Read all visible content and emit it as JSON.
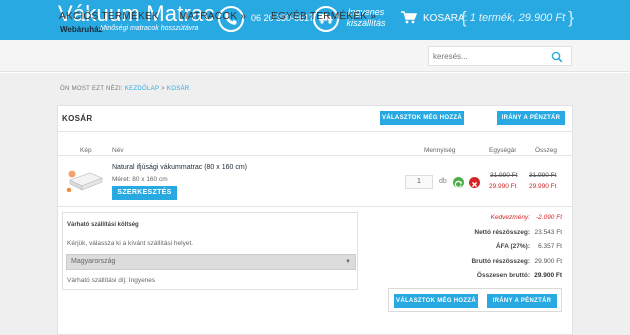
{
  "header": {
    "logo_title": "Vákuum Matrac",
    "logo_sub": "Webáruház",
    "logo_tagline": "Minőségi matracok hosszútávra",
    "phone": "06 20 330-6617",
    "shipping_line1": "Ingyenes",
    "shipping_line2": "kiszállítás",
    "cart_label": "KOSARA:",
    "cart_summary": "1 termék, 29.900 Ft"
  },
  "nav": {
    "items": [
      "AKCIÓS TERMÉKEK",
      "MATRACOK »",
      "EGYÉB TERMÉKEK »"
    ],
    "search_placeholder": "keresés..."
  },
  "breadcrumb": {
    "prefix": "ÖN MOST EZT NÉZI:",
    "home": "KEZDŐLAP",
    "sep": " > ",
    "current": "KOSÁR"
  },
  "cart": {
    "title": "KOSÁR",
    "btn_continue": "VÁLASZTOK MÉG HOZZÁ",
    "btn_checkout": "IRÁNY A PÉNZTÁR",
    "columns": [
      "Kép",
      "Név",
      "Mennyiség",
      "Egységár",
      "Összeg"
    ],
    "item": {
      "name": "Natural ifjúsági vákummatrac (80 x 160 cm)",
      "size": "Méret: 80 x 160 cm",
      "edit_label": "SZERKESZTÉS",
      "qty": "1",
      "unit": "db",
      "unit_price_old": "31.990 Ft",
      "unit_price_new": "29.990 Ft",
      "total_old": "31.990 Ft",
      "total_new": "29.990 Ft"
    }
  },
  "shipping": {
    "title": "Várható szállítási költség",
    "hint": "Kérjük, válassza ki a kívánt szállítási helyet.",
    "country": "Magyarország",
    "fee": "Várható szállítási díj: Ingyenes"
  },
  "summary": {
    "discount_label": "Kedvezmény:",
    "discount_value": "-2.090 Ft",
    "net_label": "Nettó részösszeg:",
    "net_value": "23.543 Ft",
    "vat_label": "ÁFA (27%):",
    "vat_value": "6.357 Ft",
    "gross_label": "Bruttó részösszeg:",
    "gross_value": "29.900 Ft",
    "total_label": "Összesen bruttó:",
    "total_value": "29.900 Ft"
  },
  "colors": {
    "accent": "#29a9e1",
    "price_red": "#d32626"
  }
}
